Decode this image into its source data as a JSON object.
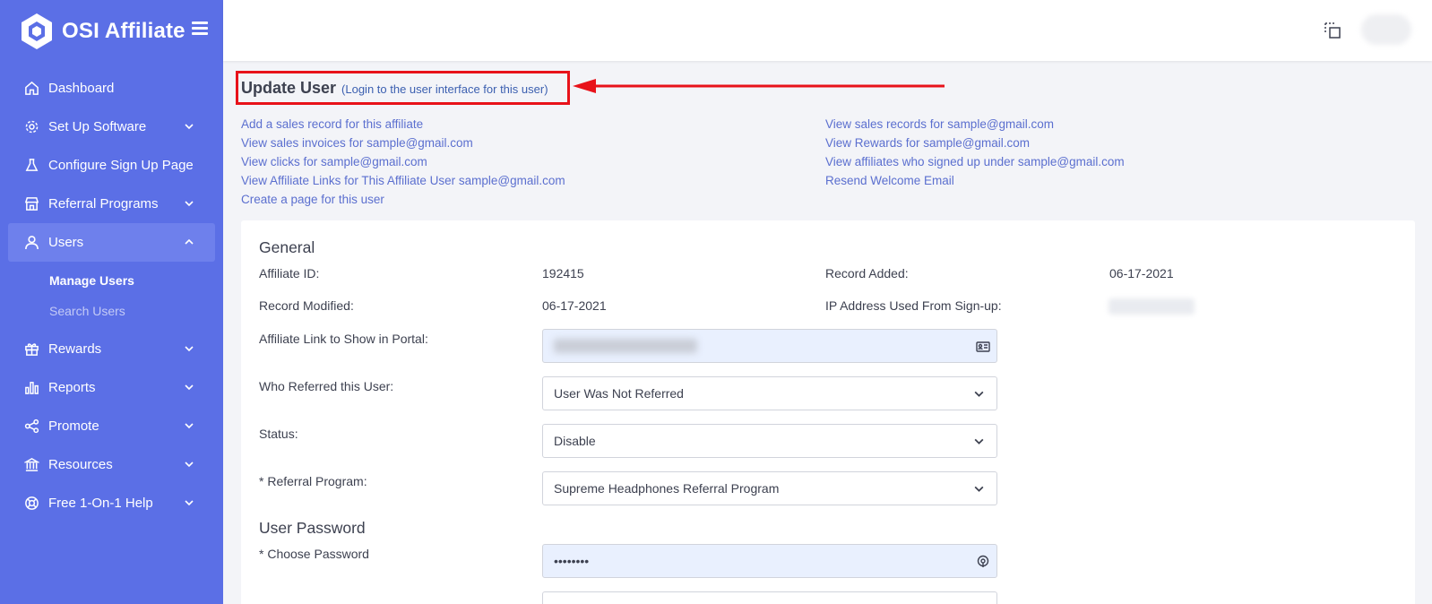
{
  "app": {
    "brand_name": "OSI Affiliate"
  },
  "sidebar": {
    "items": [
      {
        "label": "Dashboard",
        "icon": "home-icon"
      },
      {
        "label": "Set Up Software",
        "icon": "gear-icon",
        "has_chevron": true
      },
      {
        "label": "Configure Sign Up Page",
        "icon": "flask-icon"
      },
      {
        "label": "Referral Programs",
        "icon": "store-icon",
        "has_chevron": true
      },
      {
        "label": "Users",
        "icon": "user-icon",
        "has_chevron": true,
        "active": true
      },
      {
        "label": "Rewards",
        "icon": "gift-icon",
        "has_chevron": true
      },
      {
        "label": "Reports",
        "icon": "bar-chart-icon",
        "has_chevron": true
      },
      {
        "label": "Promote",
        "icon": "share-icon",
        "has_chevron": true
      },
      {
        "label": "Resources",
        "icon": "bank-icon",
        "has_chevron": true
      },
      {
        "label": "Free 1-On-1 Help",
        "icon": "lifebuoy-icon",
        "has_chevron": true
      }
    ],
    "users_sub": [
      {
        "label": "Manage Users",
        "current": true
      },
      {
        "label": "Search Users",
        "current": false
      }
    ]
  },
  "main": {
    "title": "Update User",
    "login_link": "(Login to the user interface for this user)",
    "links_left": [
      "Add a sales record for this affiliate",
      "View sales invoices for sample@gmail.com",
      "View clicks for sample@gmail.com",
      "View Affiliate Links for This Affiliate User sample@gmail.com",
      "Create a page for this user"
    ],
    "links_right": [
      "View sales records for sample@gmail.com",
      "View Rewards for sample@gmail.com",
      "View affiliates who signed up under sample@gmail.com",
      "Resend Welcome Email"
    ]
  },
  "general": {
    "title": "General",
    "affiliate_id_label": "Affiliate ID:",
    "affiliate_id": "192415",
    "record_added_label": "Record Added:",
    "record_added": "06-17-2021",
    "record_modified_label": "Record Modified:",
    "record_modified": "06-17-2021",
    "ip_label": "IP Address Used From Sign-up:",
    "affiliate_link_label": "Affiliate Link to Show in Portal:",
    "referred_label": "Who Referred this User:",
    "referred_value": "User Was Not Referred",
    "status_label": "Status:",
    "status_value": "Disable",
    "program_label": "* Referral Program:",
    "program_value": "Supreme Headphones Referral Program"
  },
  "password": {
    "title": "User Password",
    "choose_label": "* Choose Password",
    "choose_value": "••••••••"
  },
  "colors": {
    "sidebar_bg": "#5b6fe6",
    "sidebar_active": "#6e80ec",
    "link": "#5b6fcf",
    "highlight": "#e8121a"
  }
}
